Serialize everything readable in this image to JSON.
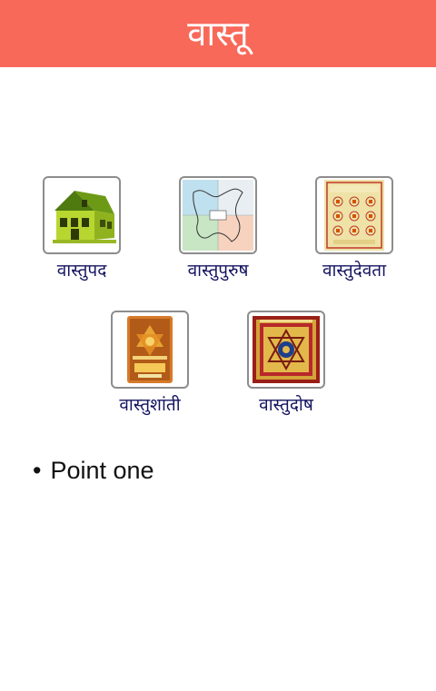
{
  "header": {
    "title": "वास्तू",
    "background": "#f8695a"
  },
  "tiles": [
    {
      "label": "वास्तुपद",
      "icon": "house-icon"
    },
    {
      "label": "वास्तुपुरुष",
      "icon": "vastu-purush-diagram-icon"
    },
    {
      "label": "वास्तुदेवता",
      "icon": "yantra-grid-icon"
    },
    {
      "label": "वास्तुशांती",
      "icon": "shanti-yantra-icon"
    },
    {
      "label": "वास्तुदोष",
      "icon": "dosh-yantra-icon"
    }
  ],
  "bullets": [
    {
      "dot": "•",
      "text": "Point one"
    }
  ],
  "colors": {
    "label": "#131360",
    "border": "#8d8d8d"
  }
}
